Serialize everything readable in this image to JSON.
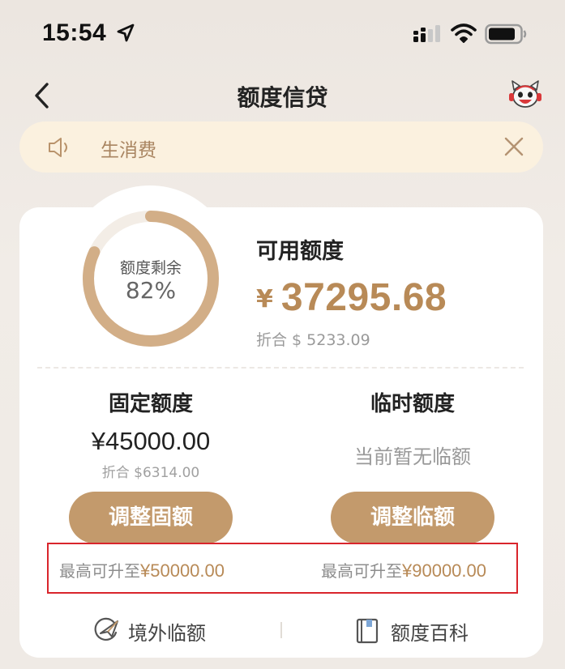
{
  "status_bar": {
    "time": "15:54",
    "icons": [
      "location-arrow-icon",
      "signal-icon",
      "wifi-icon",
      "battery-icon"
    ]
  },
  "nav": {
    "title": "额度信贷",
    "back_icon": "chevron-left-icon",
    "service_icon": "mascot-service-icon"
  },
  "notice": {
    "text": "生消费",
    "icon": "speaker-icon",
    "close_icon": "close-icon"
  },
  "summary": {
    "ring_label": "额度剩余",
    "ring_percent": "82%",
    "remaining_fraction": 0.82,
    "available_label": "可用额度",
    "currency": "¥",
    "available_amount": "37295.68",
    "converted": "折合 $ 5233.09"
  },
  "fixed": {
    "title": "固定额度",
    "amount": "¥45000.00",
    "converted": "折合 $6314.00",
    "button": "调整固额",
    "max_prefix": "最高可升至",
    "max_value": "¥50000.00"
  },
  "temporary": {
    "title": "临时额度",
    "status": "当前暂无临额",
    "button": "调整临额",
    "max_prefix": "最高可升至",
    "max_value": "¥90000.00"
  },
  "bottom_links": {
    "overseas": "境外临额",
    "encyclopedia": "额度百科"
  },
  "colors": {
    "accent": "#c39a6c",
    "amount_text": "#b88a57",
    "notice_bg": "#fbf1df",
    "highlight_border": "#d9252c"
  }
}
